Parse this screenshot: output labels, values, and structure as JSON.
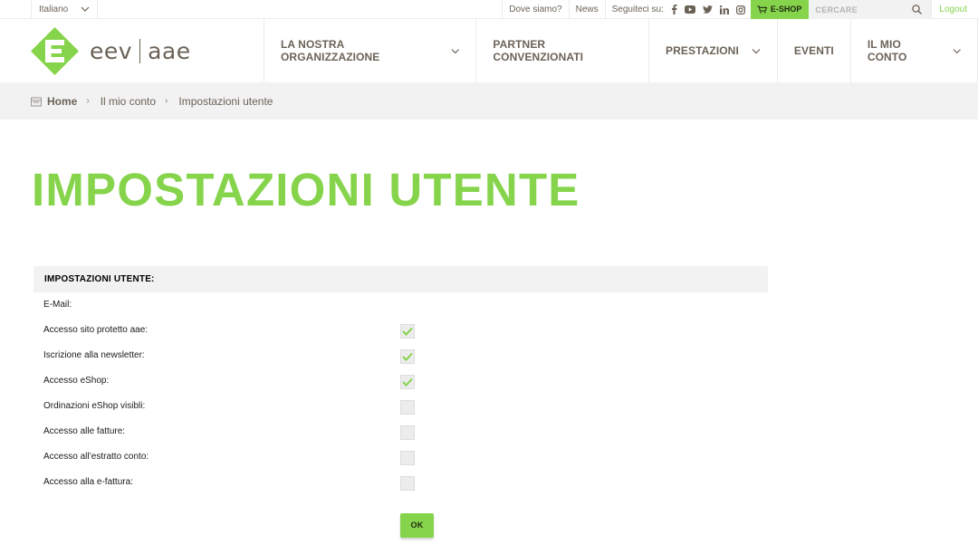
{
  "topbar": {
    "language": "Italiano",
    "where": "Dove siamo?",
    "news": "News",
    "follow": "Seguiteci su:",
    "social_icons": [
      "facebook-icon",
      "youtube-icon",
      "twitter-icon",
      "linkedin-icon",
      "instagram-icon"
    ],
    "eshop": "E-SHOP",
    "search_placeholder": "CERCARE",
    "logout": "Logout"
  },
  "logo": {
    "left": "eev",
    "right": "aae"
  },
  "nav": {
    "items": [
      {
        "label": "LA NOSTRA ORGANIZZAZIONE",
        "dropdown": true
      },
      {
        "label": "PARTNER CONVENZIONATI",
        "dropdown": false
      },
      {
        "label": "PRESTAZIONI",
        "dropdown": true
      },
      {
        "label": "EVENTI",
        "dropdown": false
      },
      {
        "label": "IL MIO CONTO",
        "dropdown": true
      }
    ]
  },
  "breadcrumb": {
    "home": "Home",
    "items": [
      "Il mio conto",
      "Impostazioni utente"
    ]
  },
  "page": {
    "title": "IMPOSTAZIONI UTENTE"
  },
  "settings": {
    "heading": "IMPOSTAZIONI UTENTE:",
    "email_label": "E-Mail:",
    "rows": [
      {
        "label": "Accesso sito protetto aae:",
        "checked": true
      },
      {
        "label": "Iscrizione alla newsletter:",
        "checked": true
      },
      {
        "label": "Accesso eShop:",
        "checked": true
      },
      {
        "label": "Ordinazioni eShop visibli:",
        "checked": false
      },
      {
        "label": "Accesso alle fatture:",
        "checked": false
      },
      {
        "label": "Accesso all’estratto conto:",
        "checked": false
      },
      {
        "label": "Accesso alla e-fattura:",
        "checked": false
      }
    ],
    "ok": "OK"
  },
  "colors": {
    "accent": "#86d44b",
    "text": "#6b6257",
    "panel": "#f2f2f2"
  }
}
